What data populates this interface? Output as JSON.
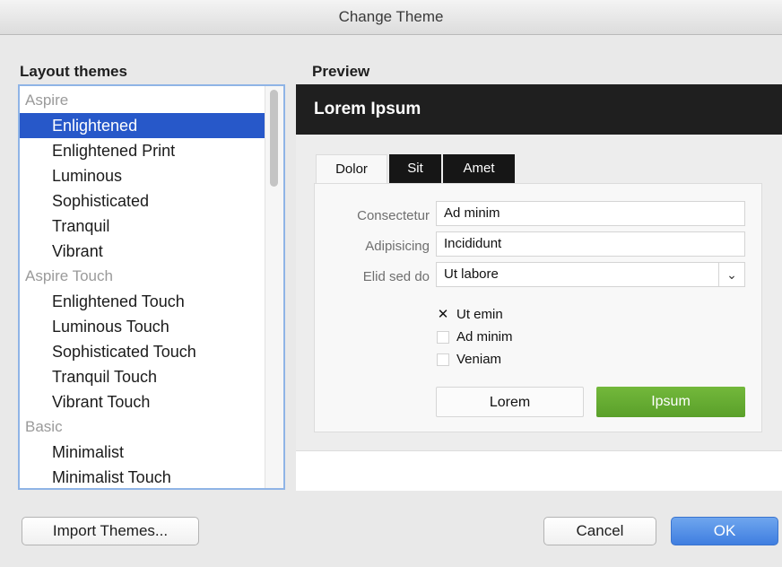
{
  "window": {
    "title": "Change Theme"
  },
  "themes": {
    "label": "Layout themes",
    "rows": [
      {
        "kind": "group",
        "label": "Aspire"
      },
      {
        "kind": "item",
        "label": "Enlightened",
        "selected": true
      },
      {
        "kind": "item",
        "label": "Enlightened Print"
      },
      {
        "kind": "item",
        "label": "Luminous"
      },
      {
        "kind": "item",
        "label": "Sophisticated"
      },
      {
        "kind": "item",
        "label": "Tranquil"
      },
      {
        "kind": "item",
        "label": "Vibrant"
      },
      {
        "kind": "group",
        "label": "Aspire Touch"
      },
      {
        "kind": "item",
        "label": "Enlightened Touch"
      },
      {
        "kind": "item",
        "label": "Luminous Touch"
      },
      {
        "kind": "item",
        "label": "Sophisticated Touch"
      },
      {
        "kind": "item",
        "label": "Tranquil Touch"
      },
      {
        "kind": "item",
        "label": "Vibrant Touch"
      },
      {
        "kind": "group",
        "label": "Basic"
      },
      {
        "kind": "item",
        "label": "Minimalist"
      },
      {
        "kind": "item",
        "label": "Minimalist Touch"
      }
    ]
  },
  "preview": {
    "label": "Preview",
    "header": "Lorem Ipsum",
    "tabs": [
      "Dolor",
      "Sit",
      "Amet"
    ],
    "fields": {
      "consectetur_label": "Consectetur",
      "consectetur_value": "Ad minim",
      "adipisicing_label": "Adipisicing",
      "adipisicing_value": "Incididunt",
      "elid_label": "Elid sed do",
      "elid_value": "Ut labore"
    },
    "checks": [
      {
        "label": "Ut emin",
        "checked": true
      },
      {
        "label": "Ad minim",
        "checked": false
      },
      {
        "label": "Veniam",
        "checked": false
      }
    ],
    "buttons": {
      "secondary": "Lorem",
      "primary": "Ipsum"
    },
    "accent_color": "#5aa02a"
  },
  "footer": {
    "import_label": "Import Themes...",
    "cancel_label": "Cancel",
    "ok_label": "OK"
  },
  "colors": {
    "selection": "#2758c9",
    "default_button": "#3f7ee0",
    "header": "#1f1f1f"
  }
}
